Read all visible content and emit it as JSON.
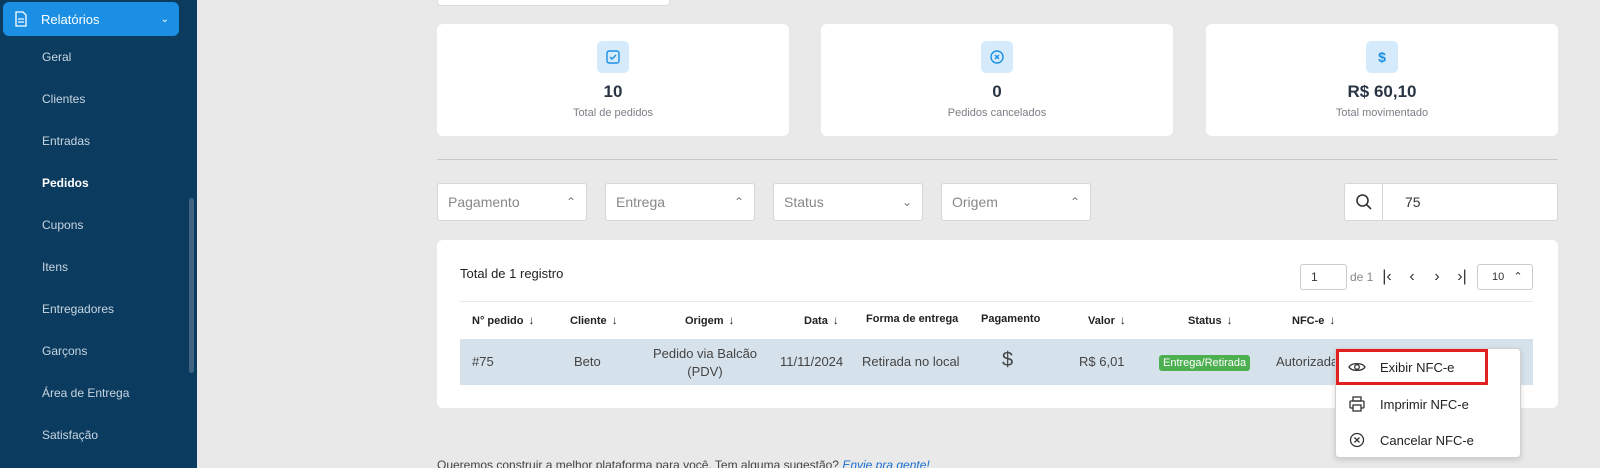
{
  "sidebar": {
    "section": "Relatórios",
    "items": [
      "Geral",
      "Clientes",
      "Entradas",
      "Pedidos",
      "Cupons",
      "Itens",
      "Entregadores",
      "Garçons",
      "Área de Entrega",
      "Satisfação"
    ],
    "active_item": "Pedidos"
  },
  "stats": [
    {
      "icon": "check-square-icon",
      "value": "10",
      "label": "Total de pedidos"
    },
    {
      "icon": "x-circle-icon",
      "value": "0",
      "label": "Pedidos cancelados"
    },
    {
      "icon": "dollar-icon",
      "value": "R$ 60,10",
      "label": "Total movimentado"
    }
  ],
  "filters": {
    "pagamento": "Pagamento",
    "entrega": "Entrega",
    "status": "Status",
    "origem": "Origem"
  },
  "search": {
    "value": "75"
  },
  "table": {
    "total": "Total de 1 registro",
    "page": "1",
    "of": "de 1",
    "page_size": "10",
    "columns": [
      "N° pedido",
      "Cliente",
      "Origem",
      "Data",
      "Forma de entrega",
      "Pagamento",
      "Valor",
      "Status",
      "NFC-e"
    ],
    "rows": [
      {
        "pedido": "#75",
        "cliente": "Beto",
        "origem_1": "Pedido via Balcão",
        "origem_2": "(PDV)",
        "data": "11/11/2024",
        "entrega": "Retirada no local",
        "pagamento": "$",
        "valor": "R$ 6,01",
        "status": "Entrega/Retirada",
        "nfce": "Autorizada"
      }
    ]
  },
  "menu": {
    "items": [
      "Exibir NFC-e",
      "Imprimir NFC-e",
      "Cancelar NFC-e"
    ]
  },
  "footer": {
    "text": "Queremos construir a melhor plataforma para você. Tem alguma sugestão?",
    "link": "Envie pra gente!"
  },
  "colors": {
    "sidebar": "#0b3b5f",
    "accent": "#1a8fe3",
    "status_green": "#4caf50",
    "highlight": "#e32020"
  }
}
